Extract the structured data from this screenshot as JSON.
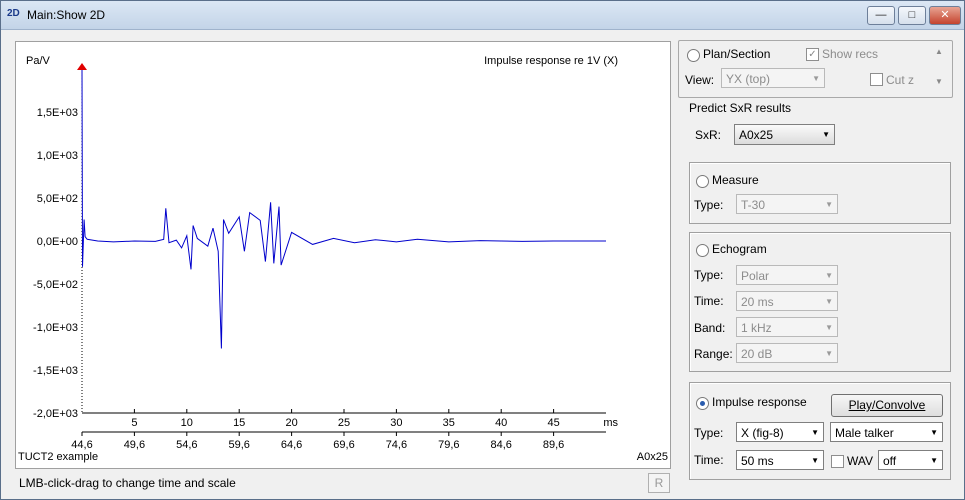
{
  "window": {
    "title": "Main:Show 2D",
    "icon_text": "2D",
    "minimize_icon": "minimize-icon",
    "maximize_icon": "maximize-icon",
    "close_icon": "close-icon"
  },
  "plot": {
    "ylabel": "Pa/V",
    "title": "Impulse response re 1V (X)",
    "footer_left": "TUCT2 example",
    "footer_right": "A0x25",
    "xunit": "ms",
    "marker_color": "#e00000",
    "trace_color": "#0000cc"
  },
  "chart_data": {
    "type": "line",
    "title": "Impulse response re 1V (X)",
    "ylabel": "Pa/V",
    "xlabel": "ms",
    "ylim": [
      -2000,
      2000
    ],
    "xlim": [
      0,
      50
    ],
    "yticks": [
      "1,5E+03",
      "1,0E+03",
      "5,0E+02",
      "0,0E+00",
      "-5,0E+02",
      "-1,0E+03",
      "-1,5E+03",
      "-2,0E+03"
    ],
    "ytick_values": [
      1500,
      1000,
      500,
      0,
      -500,
      -1000,
      -1500,
      -2000
    ],
    "xticks": [
      "5",
      "10",
      "15",
      "20",
      "25",
      "30",
      "35",
      "40",
      "45"
    ],
    "xtick_values": [
      5,
      10,
      15,
      20,
      25,
      30,
      35,
      40,
      45
    ],
    "xticks_secondary": [
      "44,6",
      "49,6",
      "54,6",
      "59,6",
      "64,6",
      "69,6",
      "74,6",
      "79,6",
      "84,6",
      "89,6"
    ],
    "xticks_secondary_values": [
      0,
      5,
      10,
      15,
      20,
      25,
      30,
      35,
      40,
      45
    ],
    "grid": false,
    "series": [
      {
        "x": [
          0,
          0.05,
          0.2,
          0.3,
          0.5,
          1.5,
          3,
          5,
          7,
          7.8,
          8,
          8.3,
          9,
          9.5,
          10,
          10.4,
          10.6,
          11,
          12,
          12.5,
          13,
          13.3,
          13.5,
          14,
          15,
          15.5,
          16,
          17,
          17.5,
          18,
          18.3,
          18.8,
          19,
          20,
          22,
          24,
          26,
          28,
          30,
          32,
          35,
          38,
          40,
          42,
          45,
          48,
          50
        ],
        "y": [
          2000,
          -300,
          250,
          50,
          20,
          0,
          -10,
          0,
          -5,
          20,
          380,
          -20,
          10,
          -80,
          60,
          -330,
          180,
          30,
          -60,
          150,
          -120,
          -1250,
          250,
          90,
          280,
          -120,
          330,
          240,
          -240,
          450,
          -260,
          400,
          -280,
          100,
          -40,
          30,
          -20,
          15,
          -10,
          20,
          -10,
          5,
          0,
          -5,
          0,
          0,
          0
        ]
      }
    ]
  },
  "status": {
    "hint": "LMB-click-drag to change time and scale",
    "r_button": "R"
  },
  "panel": {
    "plan_section": "Plan/Section",
    "show_recs": "Show recs",
    "show_recs_checked": true,
    "view_label": "View:",
    "view_value": "YX (top)",
    "cut_z": "Cut z",
    "predict_title": "Predict SxR results",
    "sxr_label": "SxR:",
    "sxr_value": "A0x25",
    "measure": "Measure",
    "measure_type_label": "Type:",
    "measure_type_value": "T-30",
    "echogram": "Echogram",
    "echo_type_label": "Type:",
    "echo_type_value": "Polar",
    "echo_time_label": "Time:",
    "echo_time_value": "20 ms",
    "echo_band_label": "Band:",
    "echo_band_value": "1 kHz",
    "echo_range_label": "Range:",
    "echo_range_value": "20 dB",
    "impulse": "Impulse response",
    "play_label": "Play/Convolve",
    "ir_type_label": "Type:",
    "ir_type_value": "X (fig-8)",
    "talker_value": "Male talker",
    "ir_time_label": "Time:",
    "ir_time_value": "50 ms",
    "wav_label": "WAV",
    "wav_value": "off"
  }
}
